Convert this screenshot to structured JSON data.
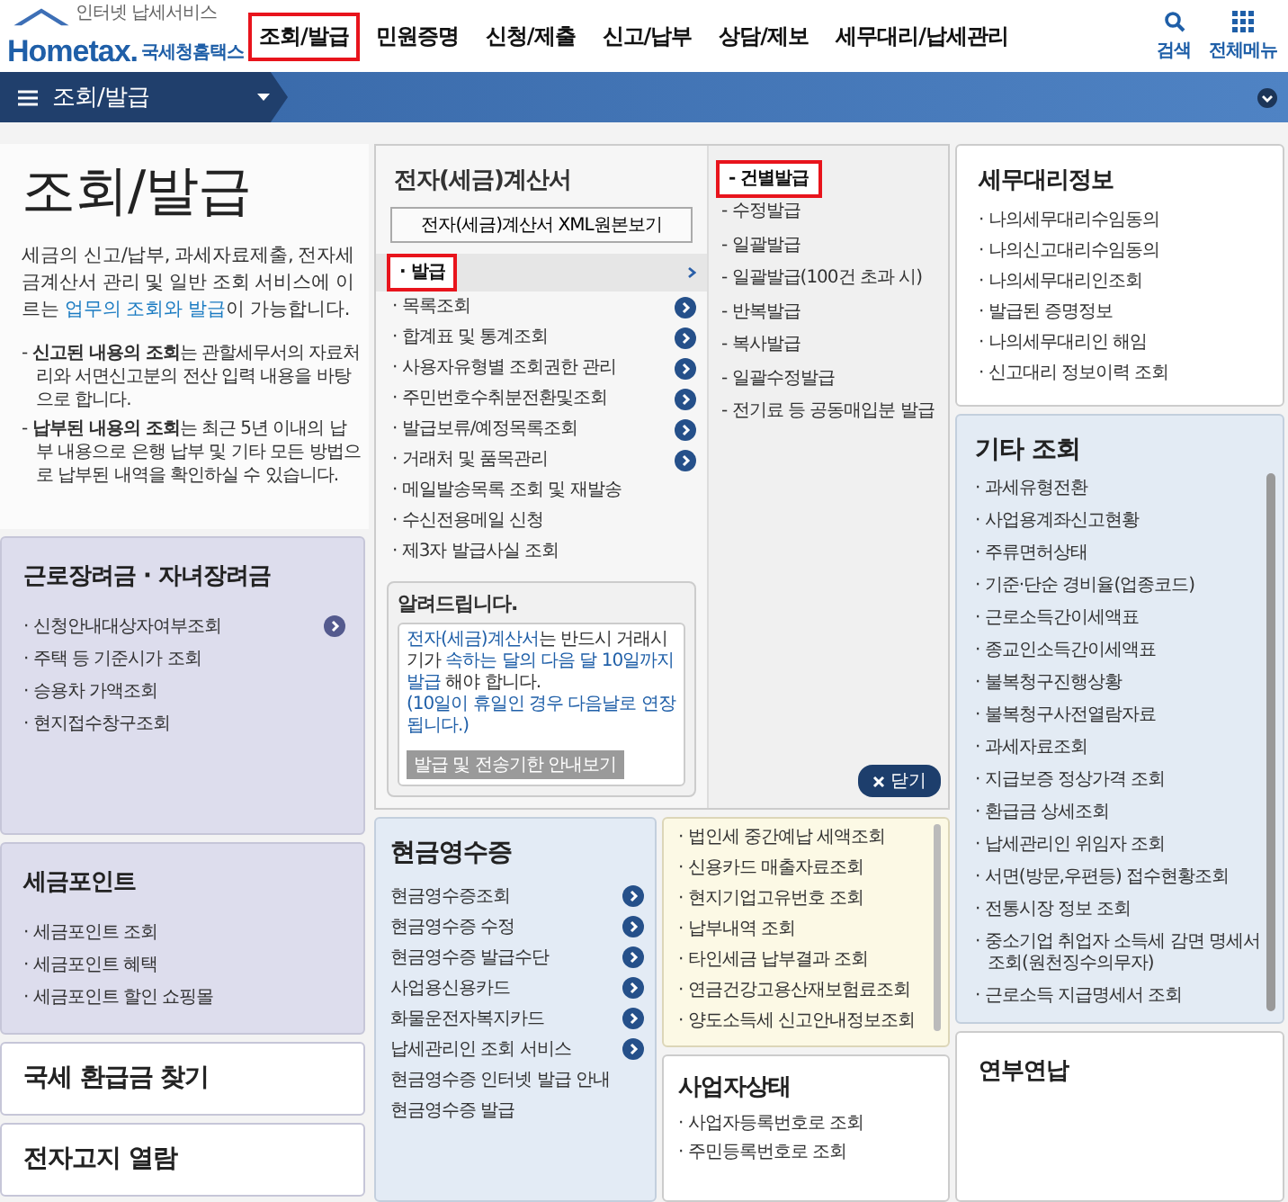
{
  "header": {
    "logo": {
      "tagline": "인터넷 납세서비스",
      "brand": "Hometax.",
      "name": "국세청홈택스"
    },
    "nav": [
      {
        "label": "조회/발급",
        "selected": true
      },
      {
        "label": "민원증명",
        "selected": false
      },
      {
        "label": "신청/제출",
        "selected": false
      },
      {
        "label": "신고/납부",
        "selected": false
      },
      {
        "label": "상담/제보",
        "selected": false
      },
      {
        "label": "세무대리/납세관리",
        "selected": false
      }
    ],
    "tools": [
      {
        "label": "검색",
        "kind": "search"
      },
      {
        "label": "전체메뉴",
        "kind": "grid"
      }
    ]
  },
  "breadcrumb": {
    "label": "조회/발급"
  },
  "intro": {
    "title": "조회/발급",
    "text_before": "세금의 신고/납부, 과세자료제출, 전자세금계산서 관리 및 일반 조회 서비스에 이르는 ",
    "link": "업무의 조회와 발급",
    "text_after": "이 가능합니다.",
    "notes": [
      "- **신고된 내용의 조회**는 관할세무서의 자료처리와 서면신고분의 전산 입력 내용을 바탕으로 합니다.",
      "- **납부된 내용의 조회**는 최근 5년 이내의 납부 내용으로 은행 납부 및 기타 모든 방법으로 납부된 내역을 확인하실 수 있습니다."
    ]
  },
  "left_cards": [
    {
      "title": "근로장려금 · 자녀장려금",
      "items": [
        {
          "label": "· 신청안내대상자여부조회",
          "arrow": true
        },
        {
          "label": "· 주택 등 기준시가 조회",
          "arrow": false
        },
        {
          "label": "· 승용차 가액조회",
          "arrow": false
        },
        {
          "label": "· 현지접수창구조회",
          "arrow": false
        }
      ]
    },
    {
      "title": "세금포인트",
      "items": [
        {
          "label": "· 세금포인트 조회",
          "arrow": false
        },
        {
          "label": "· 세금포인트 혜택",
          "arrow": false
        },
        {
          "label": "· 세금포인트 할인 쇼핑몰",
          "arrow": false
        }
      ]
    },
    {
      "title": "국세 환급금 찾기"
    },
    {
      "title": "전자고지 열람"
    }
  ],
  "menu_panel": {
    "title": "전자(세금)계산서",
    "xml_button": "전자(세금)계산서 XML원본보기",
    "categories": [
      {
        "label": "· 발급",
        "selected": true,
        "arrow": false
      },
      {
        "label": "· 목록조회",
        "selected": false,
        "arrow": true
      },
      {
        "label": "· 합계표 및 통계조회",
        "selected": false,
        "arrow": true
      },
      {
        "label": "· 사용자유형별 조회권한 관리",
        "selected": false,
        "arrow": true
      },
      {
        "label": "· 주민번호수취분전환및조회",
        "selected": false,
        "arrow": true
      },
      {
        "label": "· 발급보류/예정목록조회",
        "selected": false,
        "arrow": true
      },
      {
        "label": "· 거래처 및 품목관리",
        "selected": false,
        "arrow": true
      },
      {
        "label": "· 메일발송목록 조회 및 재발송",
        "selected": false,
        "arrow": false
      },
      {
        "label": "· 수신전용메일 신청",
        "selected": false,
        "arrow": false
      },
      {
        "label": "· 제3자 발급사실 조회",
        "selected": false,
        "arrow": false
      }
    ],
    "notice": {
      "title": "알려드립니다.",
      "segments": [
        {
          "text": "전자(세금)계산서",
          "highlight": true
        },
        {
          "text": "는 반드시 거래시기가 ",
          "highlight": false
        },
        {
          "text": "속하는 달의 다음 달 10일까지 발급",
          "highlight": true
        },
        {
          "text": " 해야 합니다.",
          "highlight": false
        }
      ],
      "footnote": "(10일이 휴일인 경우 다음날로 연장됩니다.)",
      "button": "발급 및 전송기한 안내보기"
    },
    "submenu": [
      {
        "label": "- 건별발급",
        "selected": true
      },
      {
        "label": "- 수정발급",
        "selected": false
      },
      {
        "label": "- 일괄발급",
        "selected": false
      },
      {
        "label": "- 일괄발급(100건 초과 시)",
        "selected": false
      },
      {
        "label": "- 반복발급",
        "selected": false
      },
      {
        "label": "- 복사발급",
        "selected": false
      },
      {
        "label": "- 일괄수정발급",
        "selected": false
      },
      {
        "label": "- 전기료 등 공동매입분 발급",
        "selected": false
      }
    ],
    "close_button": "닫기"
  },
  "cash_receipt": {
    "title": "현금영수증",
    "items": [
      {
        "label": "현금영수증조회",
        "arrow": true
      },
      {
        "label": "현금영수증 수정",
        "arrow": true
      },
      {
        "label": "현금영수증 발급수단",
        "arrow": true
      },
      {
        "label": "사업용신용카드",
        "arrow": true
      },
      {
        "label": "화물운전자복지카드",
        "arrow": true
      },
      {
        "label": "납세관리인 조회 서비스",
        "arrow": true
      },
      {
        "label": "현금영수증 인터넷 발급 안내",
        "arrow": false
      },
      {
        "label": "현금영수증 발급",
        "arrow": false
      }
    ]
  },
  "tax_card": {
    "items": [
      "· 법인세 중간예납 세액조회",
      "· 신용카드 매출자료조회",
      "· 현지기업고유번호 조회",
      "· 납부내역 조회",
      "· 타인세금 납부결과 조회",
      "· 연금건강고용산재보험료조회",
      "· 양도소득세 신고안내정보조회"
    ]
  },
  "business_status": {
    "title": "사업자상태",
    "items": [
      "· 사업자등록번호로 조회",
      "· 주민등록번호로 조회"
    ]
  },
  "agent_info": {
    "title": "세무대리정보",
    "items": [
      "· 나의세무대리수임동의",
      "· 나의신고대리수임동의",
      "· 나의세무대리인조회",
      "· 발급된 증명정보",
      "· 나의세무대리인 해임",
      "· 신고대리 정보이력 조회"
    ]
  },
  "other_inquiry": {
    "title": "기타 조회",
    "items": [
      "· 과세유형전환",
      "· 사업용계좌신고현황",
      "· 주류면허상태",
      "· 기준·단순 경비율(업종코드)",
      "· 근로소득간이세액표",
      "· 종교인소득간이세액표",
      "· 불복청구진행상황",
      "· 불복청구사전열람자료",
      "· 과세자료조회",
      "· 지급보증 정상가격 조회",
      "· 환급금 상세조회",
      "· 납세관리인 위임자 조회",
      "· 서면(방문,우편등) 접수현황조회",
      "· 전통시장 정보 조회",
      "· 중소기업 취업자 소득세 감면 명세서 조회(원천징수의무자)",
      "· 근로소득 지급명세서 조회"
    ]
  },
  "installment": {
    "title": "연부연납"
  }
}
